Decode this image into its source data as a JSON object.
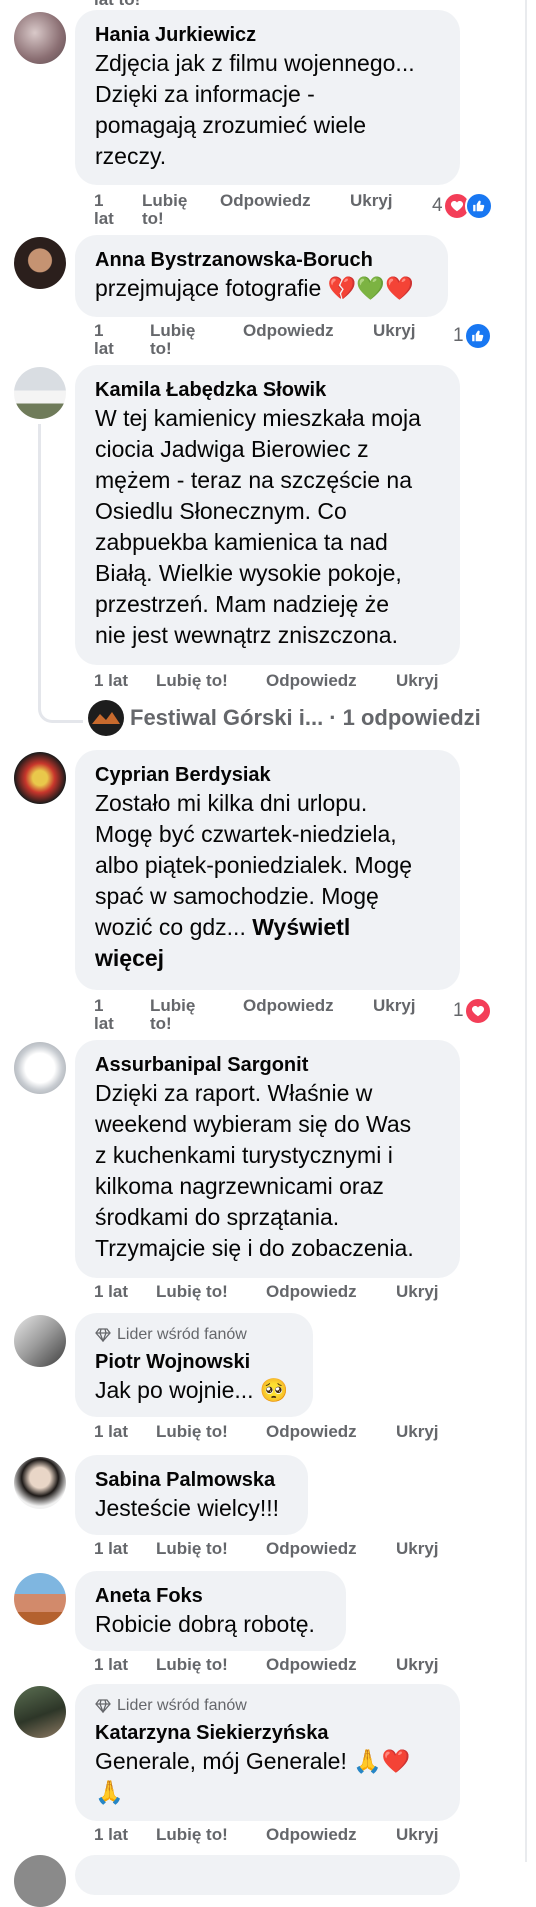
{
  "top_partial": "lat    to!",
  "comments": [
    {
      "author": "Hania Jurkiewicz",
      "text": "Zdjęcia jak z filmu wojennego...\nDzięki za informacje -\npomagają zrozumieć wiele\nrzeczy.",
      "time": "1\nlat",
      "like": "Lubię\nto!",
      "reply": "Odpowiedz",
      "hide": "Ukryj",
      "reaction_count": "4",
      "reactions": [
        "love",
        "like"
      ]
    },
    {
      "author": "Anna Bystrzanowska-Boruch",
      "text": "przejmujące fotografie 💔💚❤️",
      "time": "1\nlat",
      "like": "Lubię\nto!",
      "reply": "Odpowiedz",
      "hide": "Ukryj",
      "reaction_count": "1",
      "reactions": [
        "like"
      ]
    },
    {
      "author": "Kamila Łabędzka Słowik",
      "text": "W tej kamienicy mieszkała moja\nciocia Jadwiga Bierowiec z\nmężem - teraz na szczęście na\nOsiedlu Słonecznym. Co\nzabpuekba kamienica ta nad\nBiałą. Wielkie wysokie pokoje,\nprzestrzeń. Mam nadzieję że\nnie jest wewnątrz zniszczona.",
      "time": "1 lat",
      "like": "Lubię to!",
      "reply": "Odpowiedz",
      "hide": "Ukryj",
      "replies_author": "Festiwal Górski i...",
      "replies_count": "· 1 odpowiedzi"
    },
    {
      "author": "Cyprian Berdysiak",
      "text": "Zostało mi kilka dni urlopu.\nMogę być czwartek-niedziela,\nalbo piątek-poniedzialek. Mogę\nspać w samochodzie. Mogę\nwozić co gdz... ",
      "see_more": "Wyświetl\nwięcej",
      "time": "1\nlat",
      "like": "Lubię\nto!",
      "reply": "Odpowiedz",
      "hide": "Ukryj",
      "reaction_count": "1",
      "reactions": [
        "love"
      ]
    },
    {
      "author": "Assurbanipal Sargonit",
      "text": "Dzięki za raport. Właśnie w\nweekend wybieram się do Was\nz kuchenkami turystycznymi i\nkilkoma nagrzewnicami oraz\nśrodkami do sprzątania.\nTrzymajcie się i do zobaczenia.",
      "time": "1 lat",
      "like": "Lubię to!",
      "reply": "Odpowiedz",
      "hide": "Ukryj"
    },
    {
      "badge": "Lider wśród fanów",
      "author": "Piotr Wojnowski",
      "text": "Jak po wojnie... 🥺",
      "time": "1 lat",
      "like": "Lubię to!",
      "reply": "Odpowiedz",
      "hide": "Ukryj"
    },
    {
      "author": "Sabina Palmowska",
      "text": "Jesteście wielcy!!!",
      "time": "1 lat",
      "like": "Lubię to!",
      "reply": "Odpowiedz",
      "hide": "Ukryj"
    },
    {
      "author": "Aneta Foks",
      "text": "Robicie dobrą robotę.",
      "time": "1 lat",
      "like": "Lubię to!",
      "reply": "Odpowiedz",
      "hide": "Ukryj"
    },
    {
      "badge": "Lider wśród fanów",
      "author": "Katarzyna Siekierzyńska",
      "text": "Generale, mój Generale! 🙏❤️\n🙏",
      "time": "1 lat",
      "like": "Lubię to!",
      "reply": "Odpowiedz",
      "hide": "Ukryj"
    }
  ],
  "icons": {
    "badge": "diamond-icon",
    "love": "heart-icon",
    "like": "thumbs-up-icon"
  },
  "colors": {
    "bubble": "#f0f2f5",
    "meta": "#65676b",
    "love": "#f33e58",
    "like": "#1877f2"
  }
}
